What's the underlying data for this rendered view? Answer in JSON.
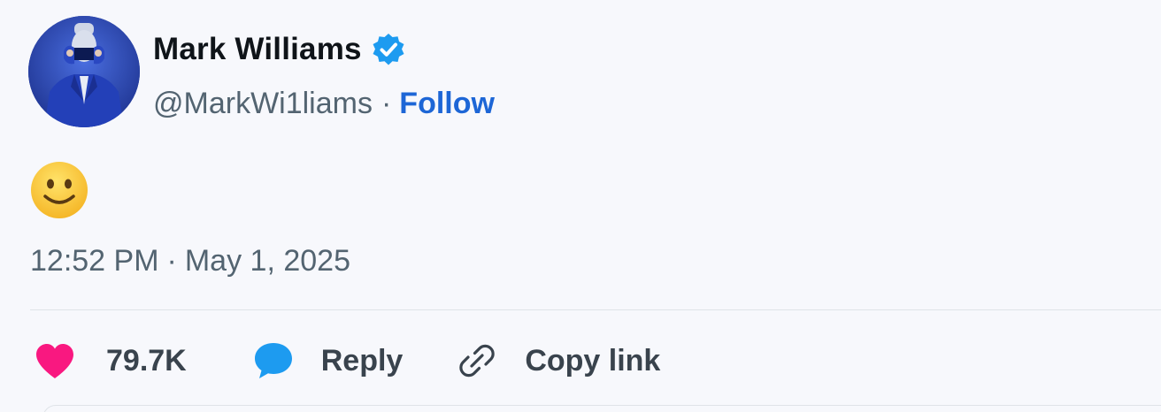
{
  "author": {
    "display_name": "Mark Williams",
    "handle": "@MarkWi1liams",
    "separator": "·",
    "follow_label": "Follow",
    "verified": true
  },
  "post": {
    "body_emoji": "slightly-smiling-face-icon",
    "time": "12:52 PM",
    "separator": "·",
    "date": "May 1, 2025"
  },
  "actions": {
    "like_count": "79.7K",
    "reply_label": "Reply",
    "copy_link_label": "Copy link"
  },
  "colors": {
    "verified_badge": "#1d9bf0",
    "follow_link": "#1d66d6",
    "like_heart": "#f91880",
    "reply_bubble": "#1d9bf0",
    "muted_text": "#536471"
  }
}
